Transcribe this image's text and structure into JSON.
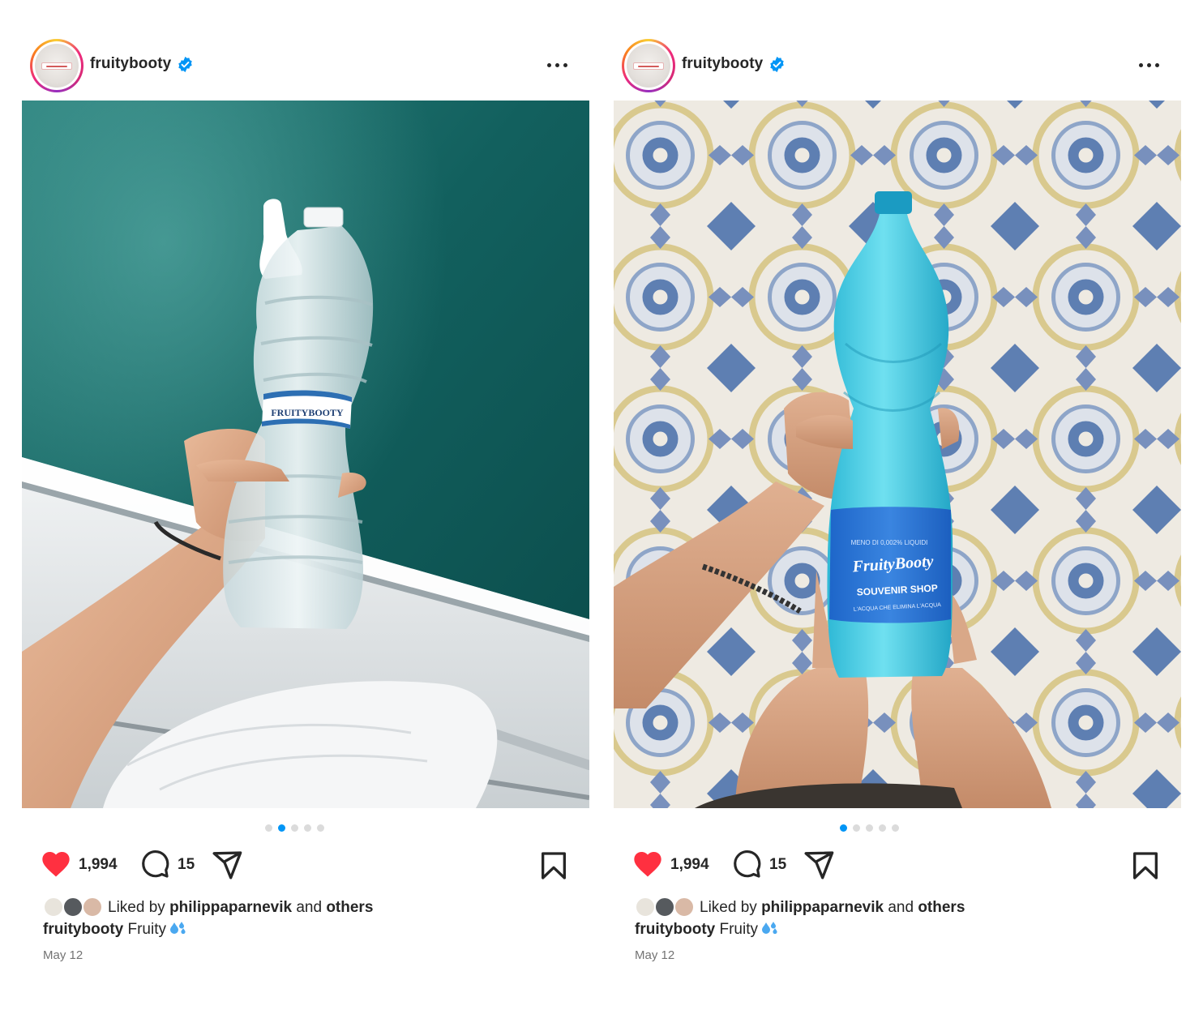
{
  "posts": [
    {
      "username": "fruitybooty",
      "verified": true,
      "likes": "1,994",
      "comments": "15",
      "carousel": {
        "count": 5,
        "active_index": 1
      },
      "liked_by_prefix": "Liked by",
      "liked_by_user": "philippaparnevik",
      "liked_by_and": "and",
      "liked_by_others": "others",
      "caption_user": "fruitybooty",
      "caption_text": "Fruity",
      "date": "May 12"
    },
    {
      "username": "fruitybooty",
      "verified": true,
      "likes": "1,994",
      "comments": "15",
      "carousel": {
        "count": 5,
        "active_index": 0
      },
      "liked_by_prefix": "Liked by",
      "liked_by_user": "philippaparnevik",
      "liked_by_and": "and",
      "liked_by_others": "others",
      "caption_user": "fruitybooty",
      "caption_text": "Fruity",
      "date": "May 12"
    }
  ],
  "photos": [
    {
      "bottle_label": "FRUITYBOOTY",
      "setting": "clear bottle over sea water from boat"
    },
    {
      "bottle_brand": "FruityBooty",
      "bottle_line": "SOUVENIR SHOP",
      "bottle_small": "MENO DI 0,002% LIQUIDI",
      "bottle_tagline": "L'ACQUA CHE ELIMINA L'ACQUA"
    }
  ],
  "icons": [
    "verified-badge-icon",
    "more-options-icon",
    "heart-icon",
    "comment-icon",
    "share-icon",
    "bookmark-icon",
    "water-drops-emoji"
  ],
  "colors": {
    "verified_blue": "#0095f6",
    "like_red": "#ff3040",
    "text": "#262626",
    "muted": "#737373"
  }
}
